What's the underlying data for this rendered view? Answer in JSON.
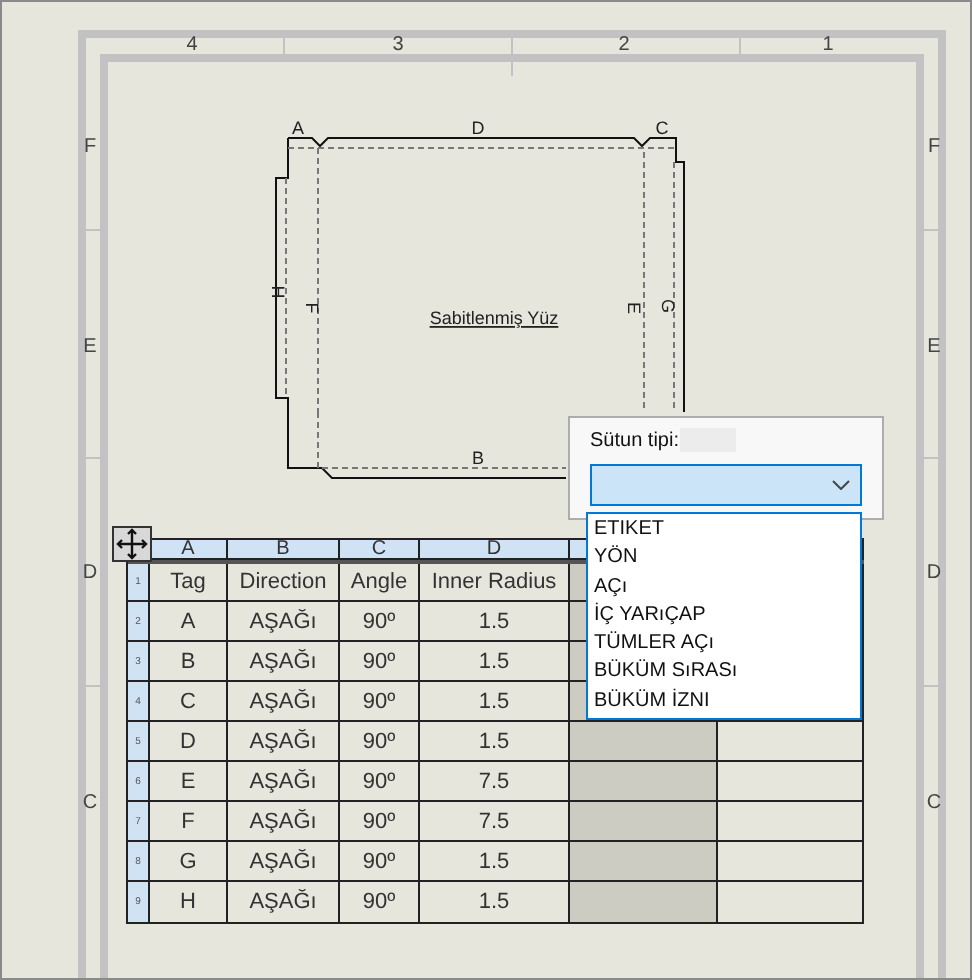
{
  "zone_columns": [
    "4",
    "3",
    "2",
    "1"
  ],
  "zone_rows_left": [
    "F",
    "E",
    "D",
    "C"
  ],
  "zone_rows_right": [
    "F",
    "E",
    "D",
    "C"
  ],
  "flat_pattern": {
    "face_label": "Sabitlenmiş Yüz",
    "edge_labels": [
      "A",
      "D",
      "C",
      "H",
      "F",
      "E",
      "G",
      "B"
    ]
  },
  "table": {
    "column_letters": [
      "A",
      "B",
      "C",
      "D"
    ],
    "rows": [
      {
        "number": "1",
        "cells": [
          "Tag",
          "Direction",
          "Angle",
          "Inner Radius"
        ]
      },
      {
        "number": "2",
        "cells": [
          "A",
          "AŞAĞı",
          "90º",
          "1.5"
        ]
      },
      {
        "number": "3",
        "cells": [
          "B",
          "AŞAĞı",
          "90º",
          "1.5"
        ]
      },
      {
        "number": "4",
        "cells": [
          "C",
          "AŞAĞı",
          "90º",
          "1.5"
        ]
      },
      {
        "number": "5",
        "cells": [
          "D",
          "AŞAĞı",
          "90º",
          "1.5"
        ]
      },
      {
        "number": "6",
        "cells": [
          "E",
          "AŞAĞı",
          "90º",
          "7.5"
        ]
      },
      {
        "number": "7",
        "cells": [
          "F",
          "AŞAĞı",
          "90º",
          "7.5"
        ]
      },
      {
        "number": "8",
        "cells": [
          "G",
          "AŞAĞı",
          "90º",
          "1.5"
        ]
      },
      {
        "number": "9",
        "cells": [
          "H",
          "AŞAĞı",
          "90º",
          "1.5"
        ]
      }
    ]
  },
  "column_type_popup": {
    "label": "Sütun tipi:",
    "options": [
      "ETIKET",
      "YÖN",
      "AÇı",
      "İÇ YARıÇAP",
      "TÜMLER AÇı",
      "BÜKÜM SıRASı",
      "BÜKÜM İZNI"
    ]
  }
}
